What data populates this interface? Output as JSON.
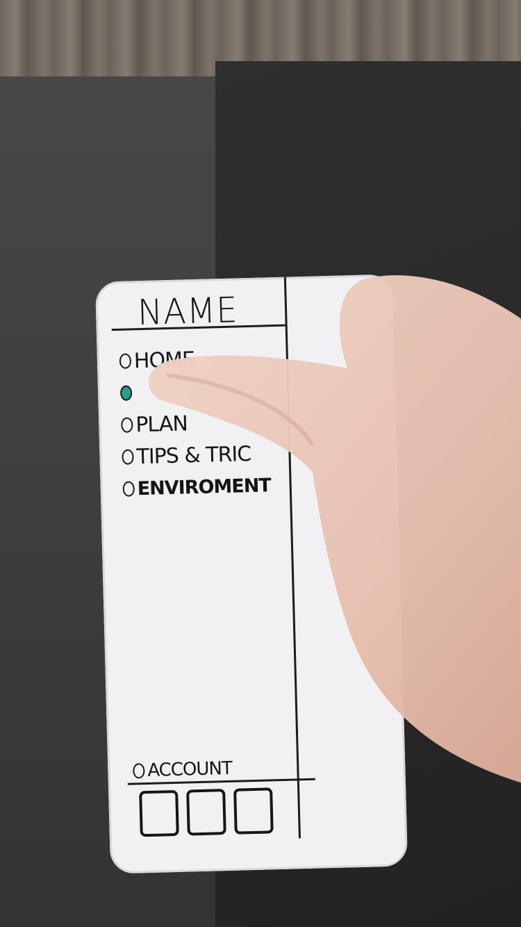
{
  "drawer": {
    "title": "NAME",
    "items": [
      {
        "label": "HOME",
        "selected": false
      },
      {
        "label": "",
        "selected": true
      },
      {
        "label": "PLAN",
        "selected": false
      },
      {
        "label": "TIPS & TRIC",
        "selected": false
      },
      {
        "label": "ENVIROMENT",
        "selected": false
      }
    ],
    "account_label": "ACCOUNT"
  },
  "tabbar": {
    "tabs": [
      "tab-1",
      "tab-2",
      "tab-3"
    ]
  },
  "colors": {
    "selected_radio": "#23a08f",
    "ink": "#161616",
    "paper": "#f1f1f3"
  }
}
